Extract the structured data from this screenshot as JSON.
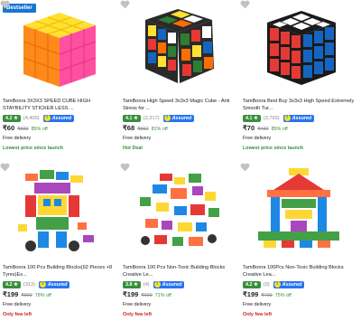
{
  "products": [
    {
      "badge": "Bestseller",
      "title": "TamBoora 3X3X3 SPEED CUBE HIGH STAYBILITY STICKER LESS ...",
      "rating": "4.2 ★",
      "count": "(4,400)",
      "assured": "Assured",
      "price": "₹60",
      "mrp": "₹399",
      "off": "85% off",
      "delivery": "Free delivery",
      "tag": "Lowest price since launch",
      "tag_color": "#388e3c",
      "image": "cube-sticker-less"
    },
    {
      "badge": "",
      "title": "TamBoora High Speed 3x3x3 Magic Cube - Anti Stress for ...",
      "rating": "4.1 ★",
      "count": "(2,317)",
      "assured": "Assured",
      "price": "₹68",
      "mrp": "₹362",
      "off": "81% off",
      "delivery": "Free delivery",
      "tag": "Hot Deal",
      "tag_color": "#388e3c",
      "image": "cube-twisted"
    },
    {
      "badge": "",
      "title": "TamBoora Best Buy 3x3x3 High Speed Extremely Smooth Tur...",
      "rating": "4.1 ★",
      "count": "(3,793)",
      "assured": "Assured",
      "price": "₹70",
      "mrp": "₹499",
      "off": "85% off",
      "delivery": "Free delivery",
      "tag": "Lowest price since launch",
      "tag_color": "#388e3c",
      "image": "cube-classic"
    },
    {
      "badge": "",
      "title": "TamBoora 100 Pcs Building Blocks(92 Pieces +8 Tyres)Ex...",
      "rating": "4.2 ★",
      "count": "(313)",
      "assured": "Assured",
      "price": "₹199",
      "mrp": "₹899",
      "off": "78% off",
      "delivery": "Free delivery",
      "tag": "Only few left",
      "tag_color": "#c62828",
      "image": "blocks-robot"
    },
    {
      "badge": "",
      "title": "TamBoora 100 Pcs Non-Toxic Building Blocks Creative Le...",
      "rating": "3.8 ★",
      "count": "(4)",
      "assured": "Assured",
      "price": "₹199",
      "mrp": "₹699",
      "off": "71% off",
      "delivery": "Free delivery",
      "tag": "Only few left",
      "tag_color": "#c62828",
      "image": "blocks-scattered"
    },
    {
      "badge": "",
      "title": "TamBoora 100Pcs Non-Toxic Building Blocks Creative Lea...",
      "rating": "4.2 ★",
      "count": "(9)",
      "assured": "Assured",
      "price": "₹199",
      "mrp": "₹799",
      "off": "75% off",
      "delivery": "Free delivery",
      "tag": "Only few left",
      "tag_color": "#c62828",
      "image": "blocks-house"
    }
  ],
  "colors": {
    "rating_bg": "#388e3c",
    "assured_bg": "#2874f0",
    "bestseller_bg": "#1976d2",
    "offer_green": "#388e3c"
  }
}
